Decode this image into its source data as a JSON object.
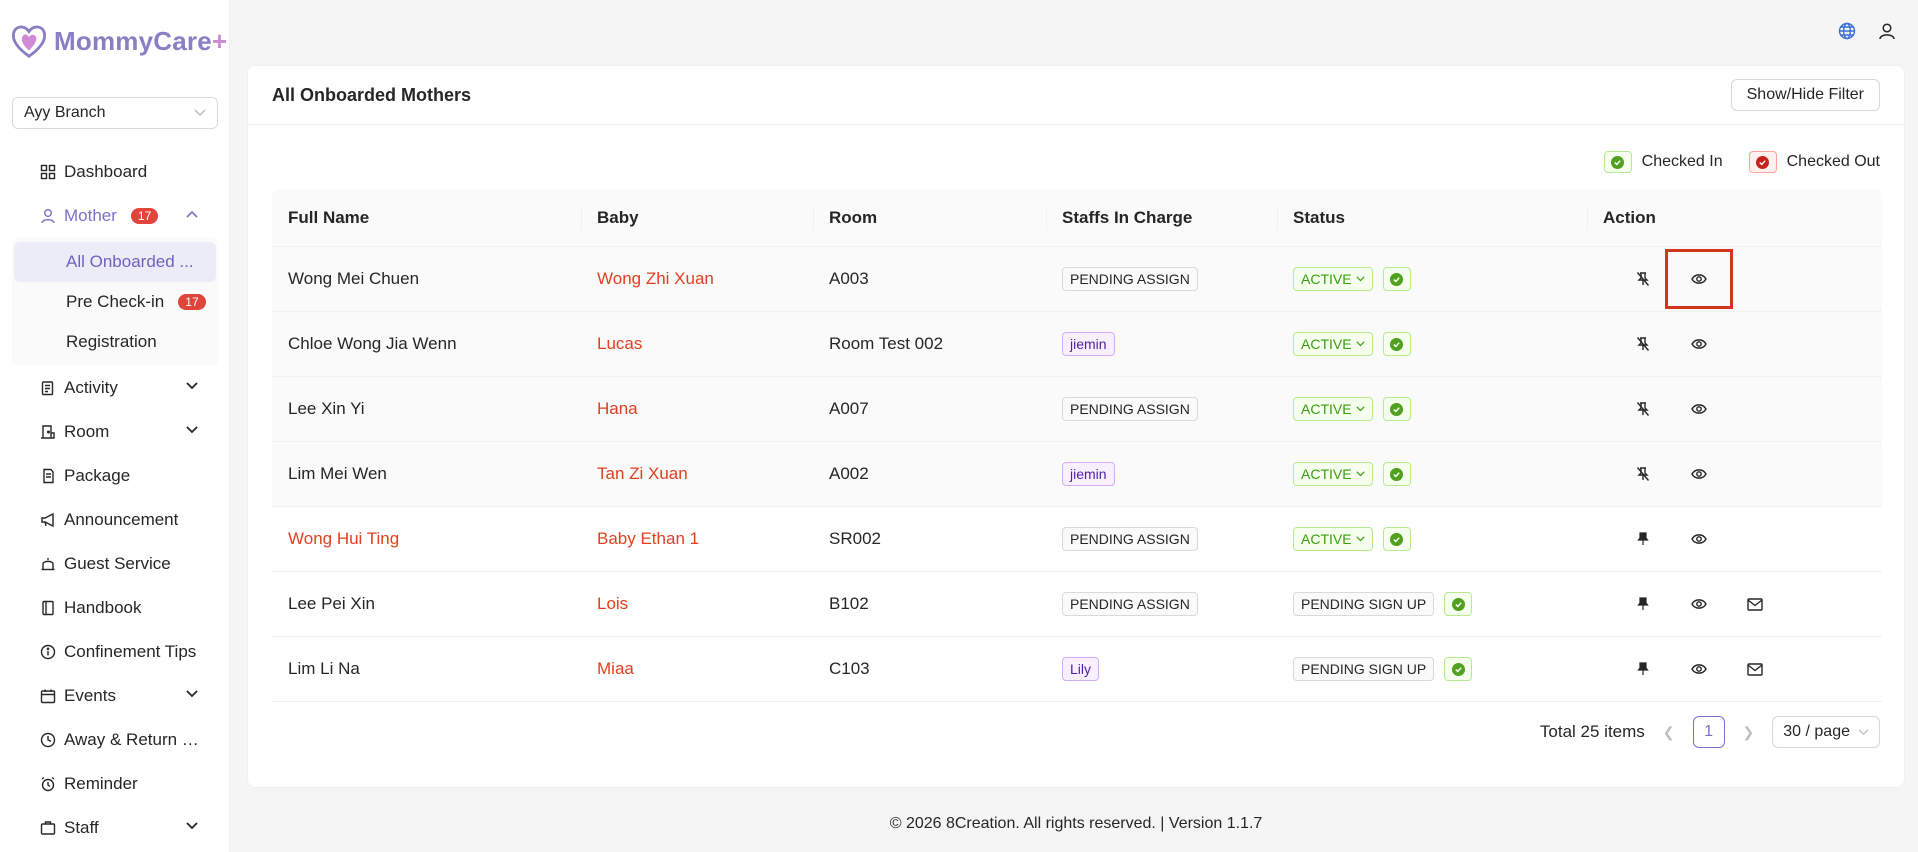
{
  "brand": {
    "name": "MommyCare",
    "plus": "+"
  },
  "branch": {
    "selected": "Ayy Branch"
  },
  "sidebar": {
    "items": [
      {
        "label": "Dashboard",
        "icon": "dashboard-icon"
      },
      {
        "label": "Mother",
        "icon": "user-icon",
        "badge": "17"
      },
      {
        "label": "Activity",
        "icon": "activity-icon"
      },
      {
        "label": "Room",
        "icon": "room-icon"
      },
      {
        "label": "Package",
        "icon": "package-icon"
      },
      {
        "label": "Announcement",
        "icon": "megaphone-icon"
      },
      {
        "label": "Guest Service",
        "icon": "bell-icon"
      },
      {
        "label": "Handbook",
        "icon": "book-icon"
      },
      {
        "label": "Confinement Tips",
        "icon": "info-icon"
      },
      {
        "label": "Events",
        "icon": "calendar-icon"
      },
      {
        "label": "Away & Return L...",
        "icon": "clock-icon"
      },
      {
        "label": "Reminder",
        "icon": "alarm-icon"
      },
      {
        "label": "Staff",
        "icon": "staff-icon"
      }
    ],
    "mother_sub": [
      {
        "label": "All Onboarded ..."
      },
      {
        "label": "Pre Check-in",
        "badge": "17"
      },
      {
        "label": "Registration"
      }
    ]
  },
  "card": {
    "title": "All Onboarded Mothers",
    "filter_button": "Show/Hide Filter"
  },
  "legend": {
    "checked_in": "Checked In",
    "checked_out": "Checked Out"
  },
  "table": {
    "headers": {
      "name": "Full Name",
      "baby": "Baby",
      "room": "Room",
      "staff": "Staffs In Charge",
      "status": "Status",
      "action": "Action"
    },
    "rows": [
      {
        "name": "Wong Mei Chuen",
        "baby": "Wong Zhi Xuan",
        "room": "A003",
        "staff": "PENDING ASSIGN",
        "status": "ACTIVE"
      },
      {
        "name": "Chloe Wong Jia Wenn",
        "baby": "Lucas",
        "room": "Room Test 002",
        "staff": "jiemin",
        "status": "ACTIVE"
      },
      {
        "name": "Lee Xin Yi",
        "baby": "Hana",
        "room": "A007",
        "staff": "PENDING ASSIGN",
        "status": "ACTIVE"
      },
      {
        "name": "Lim Mei Wen",
        "baby": "Tan Zi Xuan",
        "room": "A002",
        "staff": "jiemin",
        "status": "ACTIVE"
      },
      {
        "name": "Wong Hui Ting",
        "baby": "Baby Ethan 1",
        "room": "SR002",
        "staff": "PENDING ASSIGN",
        "status": "ACTIVE"
      },
      {
        "name": "Lee Pei Xin",
        "baby": "Lois",
        "room": "B102",
        "staff": "PENDING ASSIGN",
        "status": "PENDING SIGN UP"
      },
      {
        "name": "Lim Li Na",
        "baby": "Miaa",
        "room": "C103",
        "staff": "Lily",
        "status": "PENDING SIGN UP"
      }
    ]
  },
  "pagination": {
    "total": "Total 25 items",
    "page": "1",
    "page_size": "30 / page"
  },
  "footer": {
    "text": "© 2026 8Creation. All rights reserved. | Version 1.1.7"
  },
  "colors": {
    "accent": "#7a72c7",
    "link_red": "#e0401f",
    "badge_red": "#e0443b",
    "highlight": "#d2361e"
  }
}
